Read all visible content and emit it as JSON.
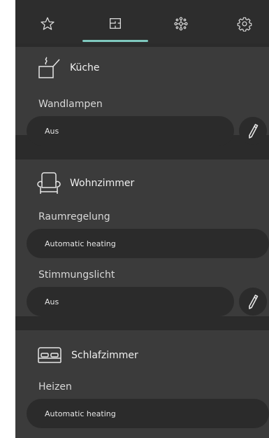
{
  "tabs": [
    {
      "icon": "star-icon"
    },
    {
      "icon": "floorplan-icon"
    },
    {
      "icon": "network-icon"
    },
    {
      "icon": "gear-icon"
    }
  ],
  "accent_color": "#7fc9bf",
  "rooms": [
    {
      "title": "Küche",
      "icon": "cooking-pot-icon",
      "controls": [
        {
          "label": "Wandlampen",
          "value": "Aus",
          "editable": true
        }
      ]
    },
    {
      "title": "Wohnzimmer",
      "icon": "armchair-icon",
      "controls": [
        {
          "label": "Raumregelung",
          "value": "Automatic heating",
          "editable": false
        },
        {
          "label": "Stimmungslicht",
          "value": "Aus",
          "editable": true
        }
      ]
    },
    {
      "title": "Schlafzimmer",
      "icon": "bed-icon",
      "controls": [
        {
          "label": "Heizen",
          "value": "Automatic heating",
          "editable": false
        }
      ]
    }
  ]
}
